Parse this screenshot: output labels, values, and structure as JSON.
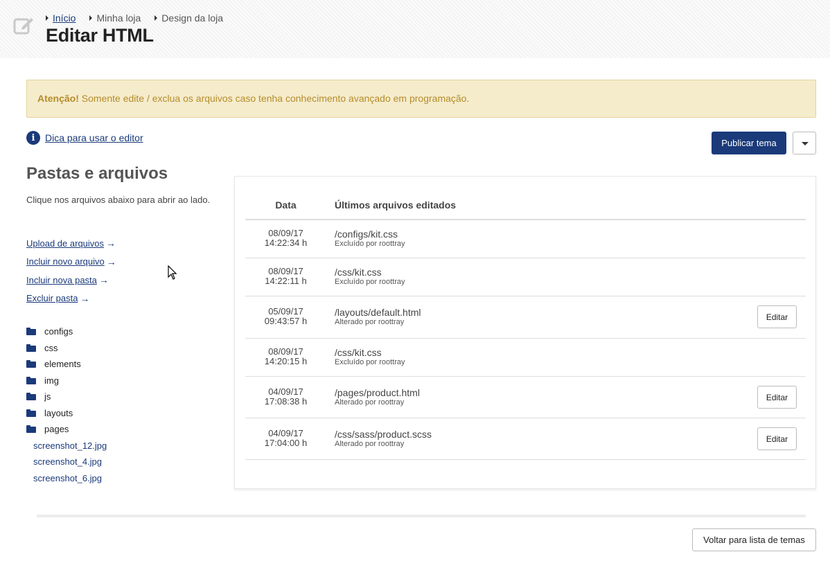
{
  "header": {
    "breadcrumb": [
      "Início",
      "Minha loja",
      "Design da loja"
    ],
    "title": "Editar HTML",
    "icon": "edit-icon"
  },
  "alert": {
    "strong": "Atenção!",
    "text": " Somente edite / exclua os arquivos caso tenha conhecimento avançado em programação.",
    "color": "#b58c2a",
    "background": "#f5eccc"
  },
  "tip": {
    "icon": "info-icon",
    "label": "Dica para usar o editor"
  },
  "toolbar": {
    "publish_label": "Publicar tema",
    "dropdown_icon": "caret-down-icon"
  },
  "sidebar": {
    "title": "Pastas e arquivos",
    "description": "Clique nos arquivos abaixo para abrir ao lado.",
    "actions": [
      "Upload de arquivos",
      "Incluir novo arquivo",
      "Incluir nova pasta",
      "Excluir pasta"
    ],
    "folders": [
      "configs",
      "css",
      "elements",
      "img",
      "js",
      "layouts",
      "pages"
    ],
    "files": [
      "screenshot_12.jpg",
      "screenshot_4.jpg",
      "screenshot_6.jpg"
    ]
  },
  "table": {
    "col_date": "Data",
    "col_files": "Últimos arquivos editados",
    "edit_label": "Editar",
    "rows": [
      {
        "date": "08/09/17",
        "time": "14:22:34 h",
        "path": "/configs/kit.css",
        "note": "Excluído por roottray",
        "editable": false
      },
      {
        "date": "08/09/17",
        "time": "14:22:11 h",
        "path": "/css/kit.css",
        "note": "Excluído por roottray",
        "editable": false
      },
      {
        "date": "05/09/17",
        "time": "09:43:57 h",
        "path": "/layouts/default.html",
        "note": "Alterado por roottray",
        "editable": true
      },
      {
        "date": "08/09/17",
        "time": "14:20:15 h",
        "path": "/css/kit.css",
        "note": "Excluído por roottray",
        "editable": false
      },
      {
        "date": "04/09/17",
        "time": "17:08:38 h",
        "path": "/pages/product.html",
        "note": "Alterado por roottray",
        "editable": true
      },
      {
        "date": "04/09/17",
        "time": "17:04:00 h",
        "path": "/css/sass/product.scss",
        "note": "Alterado por roottray",
        "editable": true
      }
    ]
  },
  "footer": {
    "back_label": "Voltar para lista de temas"
  },
  "colors": {
    "brand": "#1a3a7a"
  }
}
